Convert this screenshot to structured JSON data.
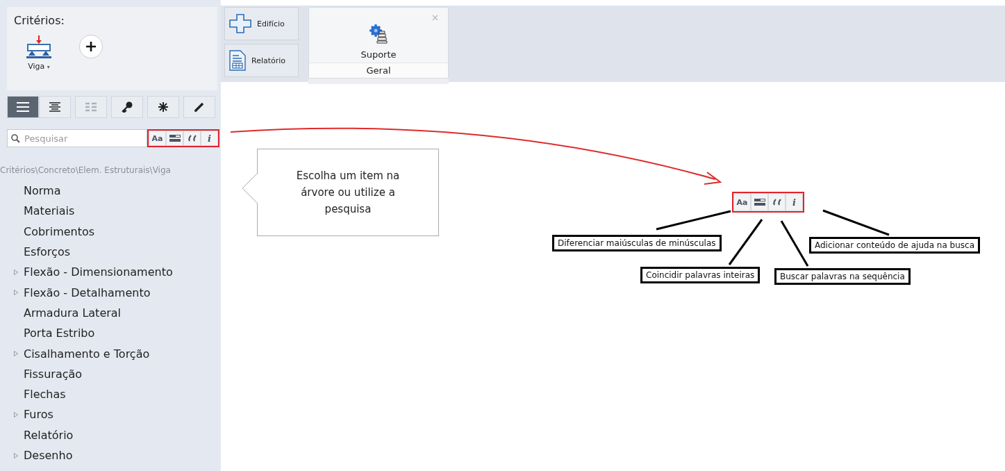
{
  "criteria": {
    "title": "Critérios:",
    "element_label": "Viga",
    "element_caret": "▾"
  },
  "view_buttons": [
    {
      "kind": "list",
      "selected": true,
      "disabled": false
    },
    {
      "kind": "center",
      "selected": false,
      "disabled": false
    },
    {
      "kind": "grid",
      "selected": false,
      "disabled": true
    },
    {
      "kind": "key",
      "selected": false,
      "disabled": false
    },
    {
      "kind": "asterisk",
      "selected": false,
      "disabled": false
    },
    {
      "kind": "pencil",
      "selected": false,
      "disabled": false
    }
  ],
  "search": {
    "placeholder": "Pesquisar",
    "options": [
      {
        "kind": "text",
        "label": "Aa"
      },
      {
        "kind": "whole-word"
      },
      {
        "kind": "quote"
      },
      {
        "kind": "italic",
        "label": "i"
      }
    ]
  },
  "breadcrumb": "Critérios\\Concreto\\Elem. Estruturais\\Viga",
  "tree": [
    {
      "label": "Norma",
      "kind": "leaf"
    },
    {
      "label": "Materiais",
      "kind": "leaf"
    },
    {
      "label": "Cobrimentos",
      "kind": "leaf"
    },
    {
      "label": "Esforços",
      "kind": "leaf"
    },
    {
      "label": "Flexão - Dimensionamento",
      "kind": "branch"
    },
    {
      "label": "Flexão - Detalhamento",
      "kind": "branch"
    },
    {
      "label": "Armadura Lateral",
      "kind": "leaf"
    },
    {
      "label": "Porta Estribo",
      "kind": "leaf"
    },
    {
      "label": "Cisalhamento e Torção",
      "kind": "branch"
    },
    {
      "label": "Fissuração",
      "kind": "leaf"
    },
    {
      "label": "Flechas",
      "kind": "leaf"
    },
    {
      "label": "Furos",
      "kind": "branch"
    },
    {
      "label": "Relatório",
      "kind": "leaf"
    },
    {
      "label": "Desenho",
      "kind": "branch"
    }
  ],
  "nav_buttons": [
    {
      "label": "Edifício",
      "kind": "building"
    },
    {
      "label": "Relatório",
      "kind": "report"
    }
  ],
  "popup": {
    "title": "Suporte",
    "section": "Geral"
  },
  "callout": "Escolha um item na árvore ou utilize a pesquisa",
  "annotation": {
    "options": [
      {
        "kind": "text",
        "label": "Aa"
      },
      {
        "kind": "whole-word"
      },
      {
        "kind": "quote"
      },
      {
        "kind": "italic",
        "label": "i"
      }
    ],
    "labels": [
      "Diferenciar maiúsculas de minúsculas",
      "Coincidir palavras inteiras",
      "Buscar palavras na sequência",
      "Adicionar conteúdo de ajuda na busca"
    ]
  }
}
